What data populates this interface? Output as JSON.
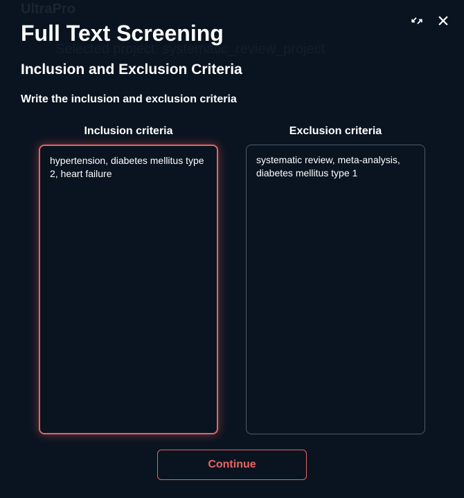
{
  "background": {
    "app_name": "UltraPro",
    "subtitle": "Selected project: systematic_review_project"
  },
  "modal": {
    "title": "Full Text Screening",
    "subtitle": "Inclusion and Exclusion Criteria",
    "instruction": "Write the inclusion and exclusion criteria",
    "inclusion": {
      "label": "Inclusion criteria",
      "value": "hypertension, diabetes mellitus type 2, heart failure"
    },
    "exclusion": {
      "label": "Exclusion criteria",
      "value": "systematic review, meta-analysis, diabetes mellitus type 1"
    },
    "continue_label": "Continue"
  }
}
